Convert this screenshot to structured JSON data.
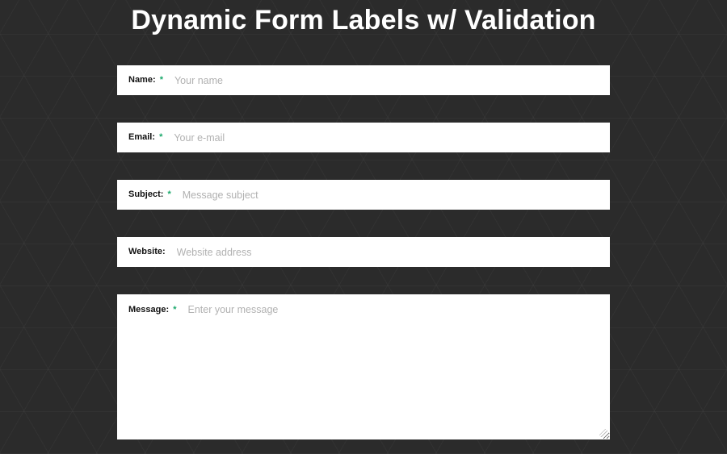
{
  "header": {
    "title": "Dynamic Form Labels w/ Validation"
  },
  "form": {
    "fields": [
      {
        "label": "Name:",
        "required": true,
        "placeholder": "Your name",
        "type": "text"
      },
      {
        "label": "Email:",
        "required": true,
        "placeholder": "Your e-mail",
        "type": "text"
      },
      {
        "label": "Subject:",
        "required": true,
        "placeholder": "Message subject",
        "type": "text"
      },
      {
        "label": "Website:",
        "required": false,
        "placeholder": "Website address",
        "type": "text"
      },
      {
        "label": "Message:",
        "required": true,
        "placeholder": "Enter your message",
        "type": "textarea"
      }
    ],
    "required_mark": "*"
  },
  "colors": {
    "required": "#1aa86b",
    "bg": "#2b2b2b"
  }
}
